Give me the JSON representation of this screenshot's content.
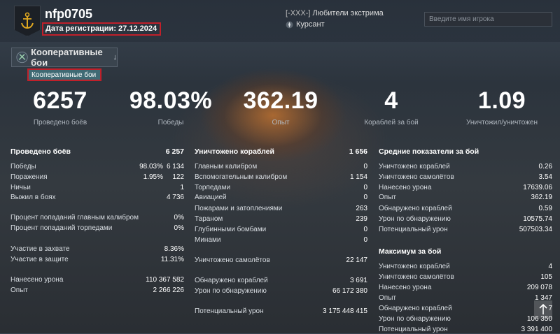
{
  "header": {
    "nickname": "nfp0705",
    "registration": "Дата регистрации: 27.12.2024",
    "clan_tag": "[-XXX-]",
    "clan_name": "Любители экстрима",
    "rank": "Курсант",
    "search_placeholder": "Введите имя игрока"
  },
  "mode": {
    "selected": "Кооперативные бои",
    "chevron": "↓",
    "option": "Кооперативные бои"
  },
  "summary": [
    {
      "value": "6257",
      "label": "Проведено боёв"
    },
    {
      "value": "98.03%",
      "label": "Победы"
    },
    {
      "value": "362.19",
      "label": "Опыт"
    },
    {
      "value": "4",
      "label": "Кораблей за бой"
    },
    {
      "value": "1.09",
      "label": "Уничтожил/уничтожен"
    }
  ],
  "col1": {
    "head": {
      "label": "Проведено боёв",
      "value": "6 257"
    },
    "rows": [
      {
        "label": "Победы",
        "pct": "98.03%",
        "value": "6 134"
      },
      {
        "label": "Поражения",
        "pct": "1.95%",
        "value": "122"
      },
      {
        "label": "Ничьи",
        "pct": "",
        "value": "1"
      },
      {
        "label": "Выжил в боях",
        "pct": "",
        "value": "4 736"
      },
      {
        "label": "Процент попаданий главным калибром",
        "pct": "",
        "value": "0%"
      },
      {
        "label": "Процент попаданий торпедами",
        "pct": "",
        "value": "0%"
      },
      {
        "label": "Участие в захвате",
        "pct": "",
        "value": "8.36%"
      },
      {
        "label": "Участие в защите",
        "pct": "",
        "value": "11.31%"
      },
      {
        "label": "Нанесено урона",
        "pct": "",
        "value": "110 367 582"
      },
      {
        "label": "Опыт",
        "pct": "",
        "value": "2 266 226"
      }
    ]
  },
  "col2": {
    "head": {
      "label": "Уничтожено кораблей",
      "value": "1 656"
    },
    "rows": [
      {
        "label": "Главным калибром",
        "value": "0"
      },
      {
        "label": "Вспомогательным калибром",
        "value": "1 154"
      },
      {
        "label": "Торпедами",
        "value": "0"
      },
      {
        "label": "Авиацией",
        "value": "0"
      },
      {
        "label": "Пожарами и затоплениями",
        "value": "263"
      },
      {
        "label": "Тараном",
        "value": "239"
      },
      {
        "label": "Глубинными бомбами",
        "value": "0"
      },
      {
        "label": "Минами",
        "value": "0"
      },
      {
        "label": "Уничтожено самолётов",
        "value": "22 147"
      },
      {
        "label": "Обнаружено кораблей",
        "value": "3 691"
      },
      {
        "label": "Урон по обнаружению",
        "value": "66 172 380"
      },
      {
        "label": "Потенциальный урон",
        "value": "3 175 448 415"
      }
    ]
  },
  "col3": {
    "head": {
      "label": "Средние показатели за бой"
    },
    "rows": [
      {
        "label": "Уничтожено кораблей",
        "value": "0.26"
      },
      {
        "label": "Уничтожено самолётов",
        "value": "3.54"
      },
      {
        "label": "Нанесено урона",
        "value": "17639.06"
      },
      {
        "label": "Опыт",
        "value": "362.19"
      },
      {
        "label": "Обнаружено кораблей",
        "value": "0.59"
      },
      {
        "label": "Урон по обнаружению",
        "value": "10575.74"
      },
      {
        "label": "Потенциальный урон",
        "value": "507503.34"
      }
    ],
    "head2": {
      "label": "Максимум за бой"
    },
    "rows2": [
      {
        "label": "Уничтожено кораблей",
        "value": "4"
      },
      {
        "label": "Уничтожено самолётов",
        "value": "105"
      },
      {
        "label": "Нанесено урона",
        "value": "209 078"
      },
      {
        "label": "Опыт",
        "value": "1 347"
      },
      {
        "label": "Обнаружено кораблей",
        "value": "7"
      },
      {
        "label": "Урон по обнаружению",
        "value": "106 350"
      },
      {
        "label": "Потенциальный урон",
        "value": "3 391 400"
      }
    ]
  }
}
